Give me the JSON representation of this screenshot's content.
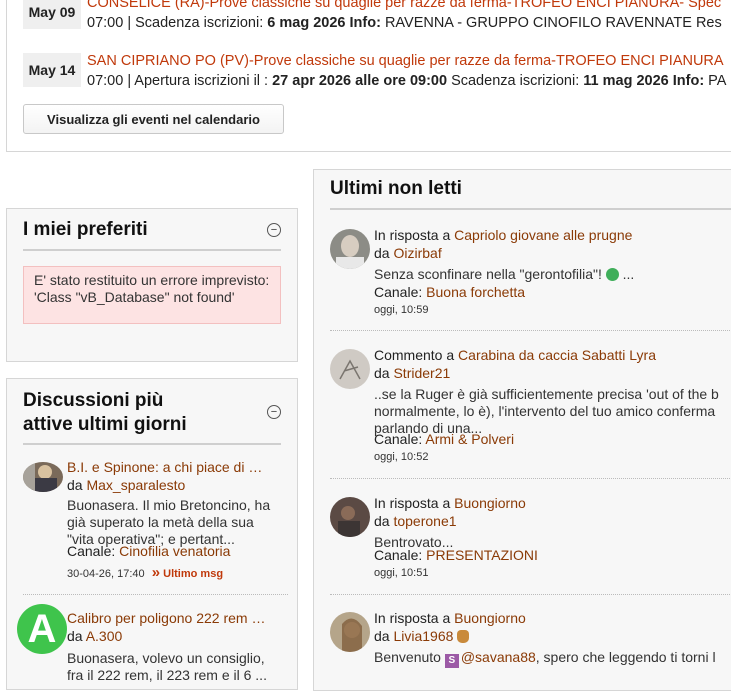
{
  "events": [
    {
      "date": "May 09",
      "title": "CONSELICE (RA)-Prove classiche su quaglie per razze da ferma-TROFEO ENCI PIANURA- Spec",
      "meta_prefix": "07:00 | Scadenza iscrizioni: ",
      "meta_bold": "6 mag 2026",
      "meta_info_label": " Info:",
      "meta_info": " RAVENNA - GRUPPO CINOFILO RAVENNATE Res"
    },
    {
      "date": "May 14",
      "title": "SAN CIPRIANO PO (PV)-Prove classiche su quaglie per razze da ferma-TROFEO ENCI PIANURA",
      "meta_prefix": "07:00 | Apertura iscrizioni il : ",
      "meta_bold": "27 apr 2026 alle ore 09:00",
      "meta_mid": " Scadenza iscrizioni: ",
      "meta_bold2": "11 mag 2026",
      "meta_info_label": " Info:",
      "meta_info": " PA"
    }
  ],
  "calendar_button": "Visualizza gli eventi nel calendario",
  "favorites": {
    "title": "I miei preferiti",
    "collapse_glyph": "−",
    "error": "E' stato restituito un errore imprevisto: 'Class \"vB_Database\" not found'"
  },
  "active": {
    "title_line1": "Discussioni più",
    "title_line2": "attive ultimi giorni",
    "collapse_glyph": "−",
    "threads": [
      {
        "title": "B.I. e Spinone: a chi piace di …",
        "by_label": "da ",
        "author": "Max_sparalesto",
        "snippet": "Buonasera. Il mio Bretoncino, ha già superato la metà della sua \"vita operativa\"; e pertant...",
        "channel_label": "Canale: ",
        "channel": "Cinofilia venatoria",
        "date": "30-04-26, 17:40",
        "last_glyph": "»",
        "last": "Ultimo msg"
      },
      {
        "title": "Calibro per poligono 222 rem …",
        "by_label": "da ",
        "author": "A.300",
        "snippet": "Buonasera, volevo un consiglio, fra il 222 rem, il 223 rem e il 6 ..."
      }
    ]
  },
  "unread": {
    "title": "Ultimi non letti",
    "posts": [
      {
        "action": "In risposta a ",
        "thread": "Capriolo giovane alle prugne",
        "by_label": "da ",
        "author": "Oizirbaf",
        "body": "Senza sconfinare nella \"gerontofilia\"! ",
        "body_end": " ...",
        "channel_label": "Canale: ",
        "channel": "Buona forchetta",
        "date": "oggi, 10:59"
      },
      {
        "action": "Commento a ",
        "thread": "Carabina da caccia Sabatti Lyra",
        "by_label": "da ",
        "author": "Strider21",
        "body_l1": "..se la Ruger è già sufficientemente precisa 'out of the b",
        "body_l2": "normalmente, lo è), l'intervento del tuo amico conferma",
        "body_l3": "parlando di una...",
        "channel_label": "Canale: ",
        "channel": "Armi & Polveri",
        "date": "oggi, 10:52"
      },
      {
        "action": "In risposta a ",
        "thread": "Buongiorno",
        "by_label": "da ",
        "author": "toperone1",
        "body": "Bentrovato...",
        "channel_label": "Canale: ",
        "channel": "PRESENTAZIONI",
        "date": "oggi, 10:51"
      },
      {
        "action": "In risposta a ",
        "thread": "Buongiorno",
        "by_label": "da ",
        "author": "Livia1968",
        "body_prefix": "Benvenuto ",
        "badge": "S",
        "mention": "@savana88",
        "body_rest": ", spero che leggendo ti torni l"
      }
    ]
  },
  "badge_letter": "A",
  "colors": {
    "link": "#8a3a06",
    "event_title": "#c0390b",
    "badge": "#3fc44c",
    "error_bg": "#fde3e3"
  }
}
